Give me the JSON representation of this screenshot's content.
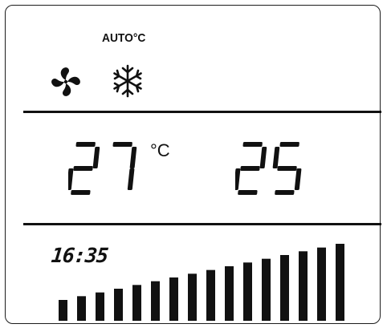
{
  "display": {
    "mode_label": "AUTO°C",
    "icons": [
      "fan-icon",
      "snowflake-icon"
    ],
    "set_temperature": "27",
    "temperature_unit": "°C",
    "room_temperature": "25",
    "clock": "16:35",
    "fan_speed_level": {
      "active_bars": 16,
      "total_bars": 16
    },
    "accent_color": "#111111"
  }
}
